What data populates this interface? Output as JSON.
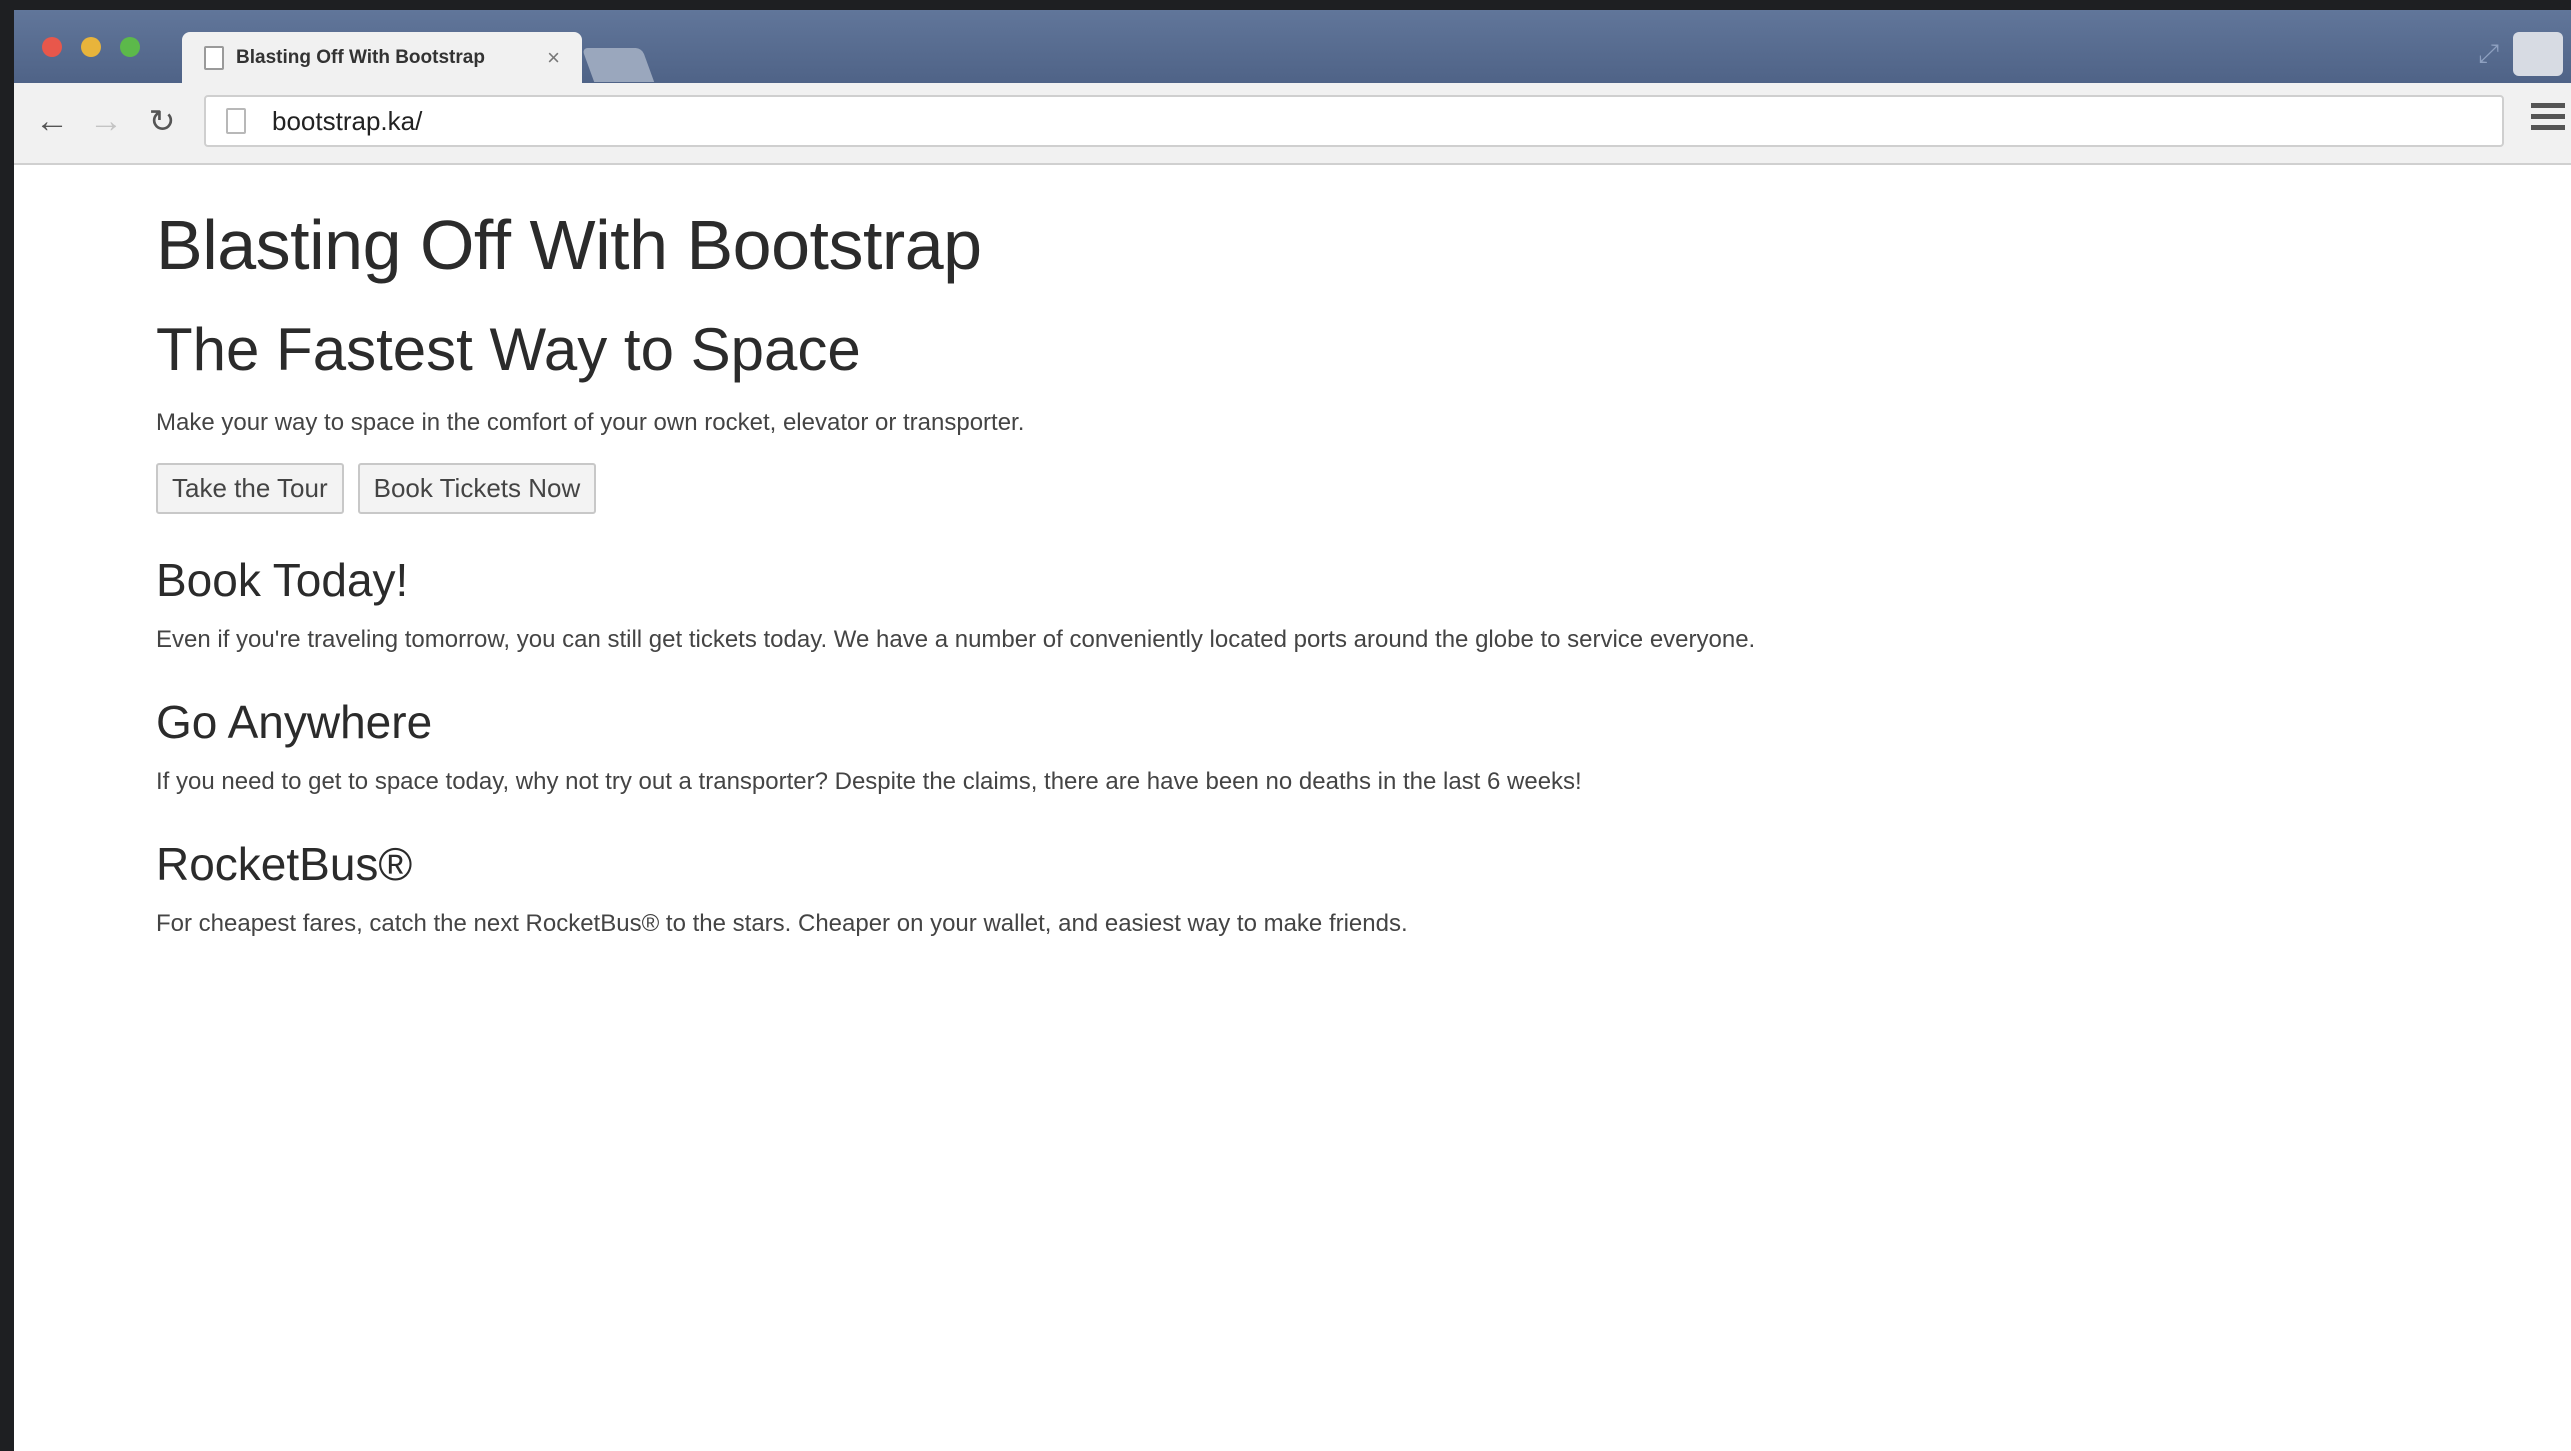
{
  "browser": {
    "tab_title": "Blasting Off With Bootstrap",
    "tab_close": "×",
    "url": "bootstrap.ka/",
    "colors": {
      "chrome_blue": "#5a6e93",
      "toolbar": "#f1f1f1"
    }
  },
  "page": {
    "title": "Blasting Off With Bootstrap",
    "hero": {
      "heading": "The Fastest Way to Space",
      "text": "Make your way to space in the comfort of your own rocket, elevator or transporter.",
      "buttons": [
        "Take the Tour",
        "Book Tickets Now"
      ]
    },
    "sections": [
      {
        "heading": "Book Today!",
        "text": "Even if you're traveling tomorrow, you can still get tickets today. We have a number of conveniently located ports around the globe to service everyone."
      },
      {
        "heading": "Go Anywhere",
        "text": "If you need to get to space today, why not try out a transporter? Despite the claims, there are have been no deaths in the last 6 weeks!"
      },
      {
        "heading": "RocketBus®",
        "text": "For cheapest fares, catch the next RocketBus® to the stars. Cheaper on your wallet, and easiest way to make friends."
      }
    ]
  }
}
